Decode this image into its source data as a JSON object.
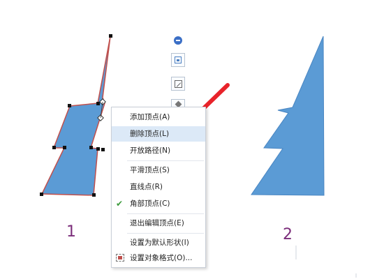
{
  "figure_labels": {
    "left": "1",
    "right": "2"
  },
  "context_menu": {
    "items": [
      {
        "label": "添加顶点(A)",
        "checked": false,
        "highlighted": false
      },
      {
        "label": "删除顶点(L)",
        "checked": false,
        "highlighted": true
      },
      {
        "label": "开放路径(N)",
        "checked": false,
        "highlighted": false
      },
      {
        "label": "平滑顶点(S)",
        "checked": false,
        "highlighted": false
      },
      {
        "label": "直线点(R)",
        "checked": false,
        "highlighted": false
      },
      {
        "label": "角部顶点(C)",
        "checked": true,
        "highlighted": false
      },
      {
        "label": "退出编辑顶点(E)",
        "checked": false,
        "highlighted": false
      },
      {
        "label": "设置为默认形状(I)",
        "checked": false,
        "highlighted": false
      },
      {
        "label": "设置对象格式(O)...",
        "checked": false,
        "highlighted": false
      }
    ]
  },
  "colors": {
    "shape_fill": "#5b9bd5",
    "selected_outline": "#c0504d",
    "annotation_red": "#e8232a",
    "label_color": "#7b2d7a",
    "check_green": "#3b9a3b"
  },
  "icons": [
    "minus-circle-icon",
    "layout-options-icon",
    "edit-shape-icon",
    "fill-bucket-icon",
    "format-object-icon"
  ]
}
